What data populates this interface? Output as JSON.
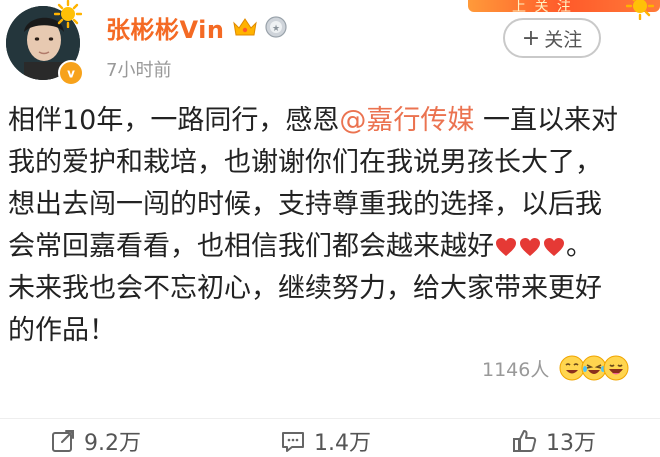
{
  "header": {
    "username": "张彬彬Vin",
    "timestamp": "7小时前",
    "follow_label": "关注",
    "follow_plus": "+",
    "corner_banner_text": "上 关 注"
  },
  "content": {
    "lines": [
      [
        "相伴10年，一路同行，感恩",
        "@嘉行传媒",
        "一直以来对"
      ],
      [
        "我的爱护和栽培，也谢谢你们在我说男孩长大了，"
      ],
      [
        "想出去闯一闯的时候，支持尊重我的选择，以后我"
      ],
      [
        "会常回嘉看看，也相信我们都会越来越好",
        "。"
      ],
      [
        "未来我也会不忘初心，继续努力，给大家带来更好"
      ],
      [
        "的作品！"
      ]
    ],
    "heart_count": 3
  },
  "reactions": {
    "count": "1146人",
    "emoji_icons": [
      "laugh-cry-icon",
      "grin-tears-icon",
      "laughing-icon"
    ]
  },
  "actions": {
    "repost": "9.2万",
    "comment": "1.4万",
    "like": "13万"
  },
  "colors": {
    "username": "#f46a24",
    "mention": "#eb7350",
    "heart": "#e53935",
    "muted": "#999999"
  }
}
